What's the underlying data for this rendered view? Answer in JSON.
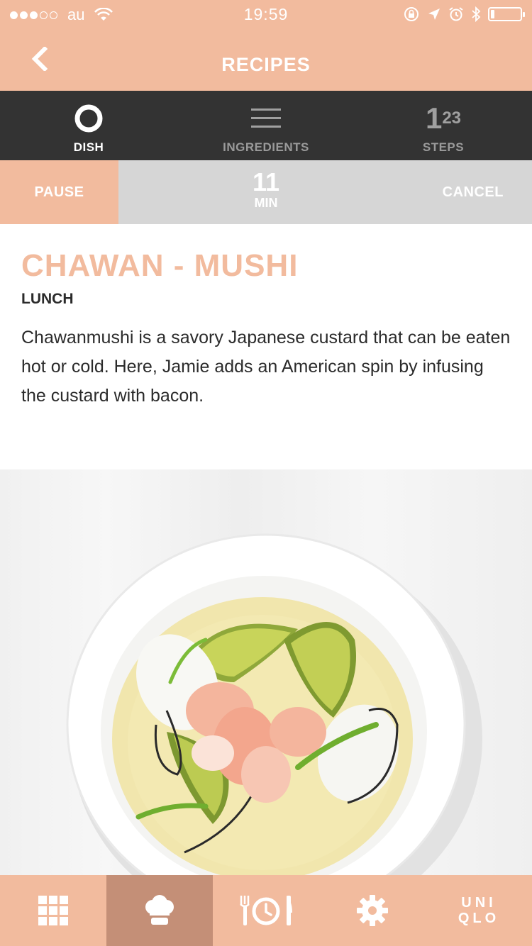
{
  "status_bar": {
    "carrier": "au",
    "time": "19:59",
    "battery_level": 0.12
  },
  "header": {
    "title": "RECIPES"
  },
  "tabs": [
    {
      "label": "DISH",
      "icon": "ring-icon",
      "active": true
    },
    {
      "label": "INGREDIENTS",
      "icon": "list-icon",
      "active": false
    },
    {
      "label": "STEPS",
      "icon": "steps-123-icon",
      "active": false
    }
  ],
  "steps_icon": {
    "big": "1",
    "small": "23"
  },
  "timer": {
    "pause_label": "PAUSE",
    "value": "11",
    "unit": "MIN",
    "cancel_label": "CANCEL"
  },
  "dish": {
    "title": "CHAWAN - MUSHI",
    "category": "LUNCH",
    "description": "Chawanmushi is a savory Japanese custard that can be eaten hot or cold. Here, Jamie adds an American spin by infusing the custard with bacon."
  },
  "bottom_nav": [
    {
      "icon": "grid-icon"
    },
    {
      "icon": "chef-hat-icon",
      "active": true
    },
    {
      "icon": "fork-clock-knife-icon"
    },
    {
      "icon": "gear-icon"
    },
    {
      "icon": "uniqlo-logo-icon",
      "logo_line1": "UNI",
      "logo_line2": "QLO"
    }
  ],
  "colors": {
    "accent": "#f2bb9e",
    "accent_dark": "#c48f77",
    "tabbar": "#333333",
    "timer_bg": "#d6d6d6"
  }
}
